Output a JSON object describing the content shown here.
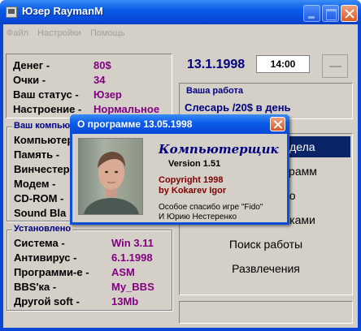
{
  "window": {
    "title": "Юзер RaymanM"
  },
  "menu": [
    "Файл",
    "Настройки",
    "Помощь"
  ],
  "stats": {
    "money_label": "Денег -",
    "money": "80$",
    "points_label": "Очки -",
    "points": "34",
    "status_label": "Ваш статус -",
    "status": "Юзер",
    "mood_label": "Настроение -",
    "mood": "Нормальное"
  },
  "clock": {
    "date": "13.1.1998",
    "time": "14:00"
  },
  "work": {
    "group": "Ваша работа",
    "job": "Слесарь  /20$ в день"
  },
  "computer": {
    "group": "Ваш компьютер",
    "rows": [
      "Компьютер",
      "Память -",
      "Винчестер",
      "Модем -",
      "CD-ROM -",
      "Sound Bla"
    ]
  },
  "software": {
    "group": "Установлено",
    "rows": [
      {
        "label": "Система -",
        "value": "Win 3.11"
      },
      {
        "label": "Антивирус -",
        "value": "6.1.1998"
      },
      {
        "label": "Программи-е -",
        "value": "ASM"
      },
      {
        "label": "BBS'ка -",
        "value": "My_BBS"
      },
      {
        "label": "Другой soft -",
        "value": "13Mb"
      }
    ]
  },
  "actions": [
    "е дела",
    "ограмм",
    "во",
    "S'ками",
    "Поиск работы",
    "Развлечения"
  ],
  "about": {
    "title": "О программе   13.05.1998",
    "product": "Компьютерщик",
    "version": "Version 1.51",
    "copyright": "Copyright 1998",
    "author": "by Kokarev Igor",
    "thanks1": "Особое спасибо игре \"Fido\"",
    "thanks2": "И Юрию Нестеренко"
  },
  "colors": {
    "title_blue": "#0a50d8",
    "face": "#d4d0c8",
    "value_purple": "#800080",
    "label_navy": "#000080"
  }
}
